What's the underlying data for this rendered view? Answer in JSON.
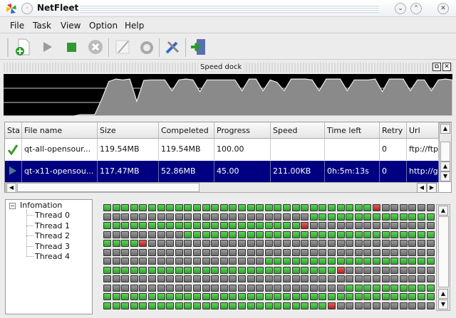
{
  "window": {
    "title": "NetFleet"
  },
  "menu": [
    "File",
    "Task",
    "View",
    "Option",
    "Help"
  ],
  "toolbar": [
    {
      "name": "new-task-icon"
    },
    {
      "name": "start-icon"
    },
    {
      "name": "stop-icon"
    },
    {
      "name": "delete-icon"
    },
    {
      "name": "edit-icon"
    },
    {
      "name": "refresh-icon"
    },
    {
      "name": "settings-icon"
    },
    {
      "name": "exit-icon"
    }
  ],
  "speed_dock": {
    "title": "Speed dock",
    "samples": [
      0,
      0,
      0,
      0,
      0,
      0,
      0,
      0,
      0,
      0,
      0,
      3,
      3,
      3,
      40,
      82,
      88,
      86,
      88,
      35,
      85,
      86,
      86,
      86,
      60,
      86,
      88,
      86,
      58,
      86,
      86,
      86,
      86,
      86,
      60,
      88,
      88,
      60,
      86,
      80,
      60,
      88,
      88,
      88,
      86,
      60,
      88,
      88,
      88,
      60,
      86,
      86,
      86,
      88,
      58,
      88,
      88,
      88,
      60,
      86,
      86,
      60,
      86,
      88,
      86
    ]
  },
  "table": {
    "columns": [
      "Sta",
      "File name",
      "Size",
      "Compeleted",
      "Progress",
      "Speed",
      "Time left",
      "Retry",
      "Url"
    ],
    "rows": [
      {
        "status": "done",
        "name": "qt-all-opensour...",
        "size": "119.54MB",
        "completed": "119.54MB",
        "progress": "100.00",
        "speed": "",
        "time_left": "",
        "retry": "0",
        "url": "ftp://ftp"
      },
      {
        "status": "running",
        "name": "qt-x11-opensou...",
        "size": "117.47MB",
        "completed": "52.86MB",
        "progress": "45.00",
        "speed": "211.00KB",
        "time_left": "0h:5m:13s",
        "retry": "0",
        "url": "http://g"
      }
    ]
  },
  "tree": {
    "root": "Infomation",
    "children": [
      "Thread 0",
      "Thread 1",
      "Thread 2",
      "Thread 3",
      "Thread 4"
    ]
  },
  "blocks": {
    "colors": {
      "done": "#3cb837",
      "pending": "#7a7a7a",
      "active": "#c83030"
    },
    "rows": [
      "GGGGGGGGGGGGGGGGGGGGGGGGGGGGGGRgggggg",
      "gggggggggggggggggggggggGGGGGGGGGGGGGG",
      "GGGGGGGGGGGGGGGGGGGGGGRgggggggggggggg",
      "gggggggggGGGGGGGGGGGGGGGGGGGGGGGGGGGG",
      "GGGGRgggggggggggggggggggggggggggggggg",
      "ggggggggggggggggggggggggggggggggggggg",
      "ggggggggggggggggggGGGGGGGGGGGGGGGGGGG",
      "GGGGGGGGGGGGGGGGGGGGGGGGGGRgggggggggg",
      "ggggggggggggggggggggggggggggggggggggg",
      "gggggggggggggggggggggggggggGGGGGGGGGG",
      "GGGGGGGGGGGGGGGGGGGGGGGGGGGGGGGGGGGGG",
      "GGGGGGGGGGGGGGGGGGGGGGGGGRggggggggggg"
    ]
  }
}
